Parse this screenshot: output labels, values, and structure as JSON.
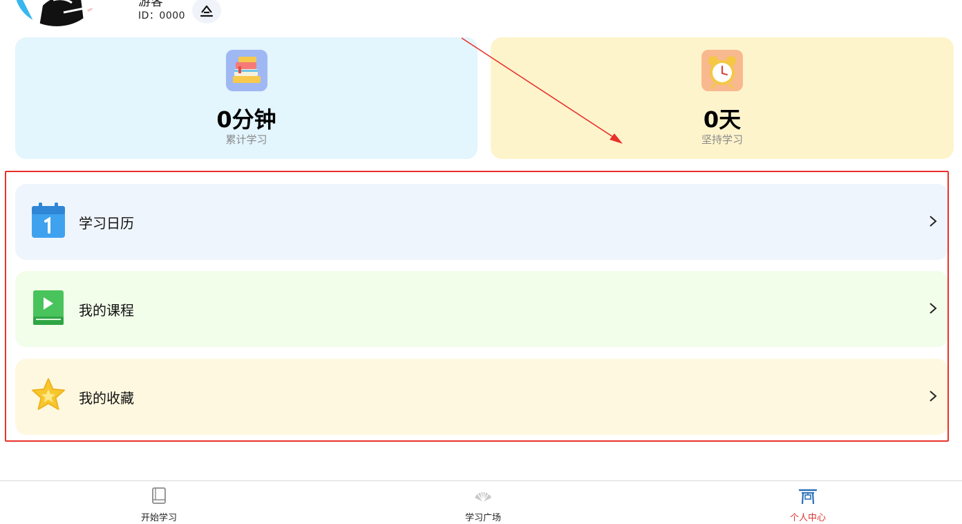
{
  "header": {
    "user_name": "游客",
    "user_id": "ID：0000",
    "avatar_icon": "avatar-illustration",
    "edit_icon": "eraser-icon"
  },
  "stats": [
    {
      "value": "0分钟",
      "label": "累计学习",
      "icon": "books-icon",
      "bg": "#e3f5fd"
    },
    {
      "value": "0天",
      "label": "坚持学习",
      "icon": "alarm-clock-icon",
      "bg": "#fef4cc"
    }
  ],
  "menu": [
    {
      "label": "学习日历",
      "icon": "calendar-icon",
      "bg": "#eff5fc"
    },
    {
      "label": "我的课程",
      "icon": "video-course-icon",
      "bg": "#f2fdea"
    },
    {
      "label": "我的收藏",
      "icon": "star-icon",
      "bg": "#fef8e0"
    }
  ],
  "tabs": [
    {
      "label": "开始学习",
      "icon": "book-icon",
      "active": false
    },
    {
      "label": "学习广场",
      "icon": "fan-icon",
      "active": false
    },
    {
      "label": "个人中心",
      "icon": "gate-icon",
      "active": true
    }
  ],
  "colors": {
    "active_tab": "#d9352f",
    "annotation": "#e8312a"
  }
}
